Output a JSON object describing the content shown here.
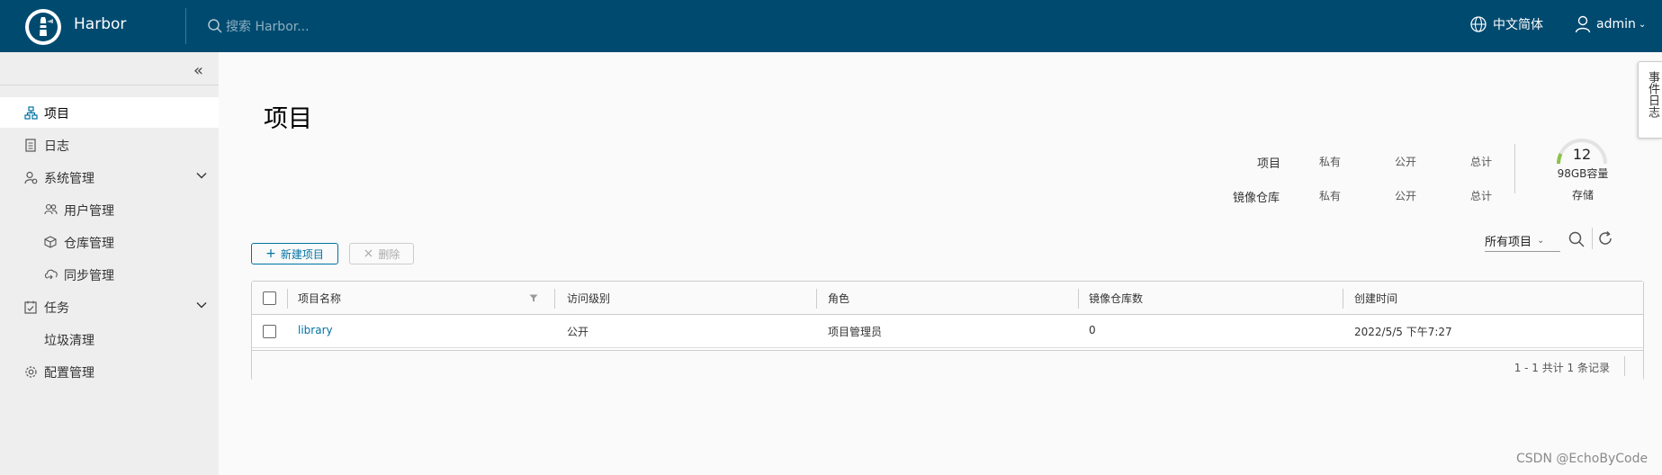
{
  "header": {
    "brand": "Harbor",
    "search_placeholder": "搜索 Harbor...",
    "language": "中文简体",
    "user": "admin"
  },
  "sidebar": {
    "items": [
      {
        "label": "项目",
        "icon": "project-icon",
        "active": true
      },
      {
        "label": "日志",
        "icon": "log-icon"
      },
      {
        "label": "系统管理",
        "icon": "system-admin-icon",
        "expanded": true
      },
      {
        "label": "用户管理",
        "icon": "users-icon"
      },
      {
        "label": "仓库管理",
        "icon": "registry-icon"
      },
      {
        "label": "同步管理",
        "icon": "replication-icon"
      },
      {
        "label": "任务",
        "icon": "tasks-icon",
        "expanded": true
      },
      {
        "label": "垃圾清理",
        "icon": ""
      },
      {
        "label": "配置管理",
        "icon": "config-icon"
      }
    ]
  },
  "main": {
    "title": "项目",
    "stats": {
      "row1_label": "项目",
      "row2_label": "镜像仓库",
      "private": "私有",
      "public": "公开",
      "total": "总计",
      "gauge_value": "12",
      "gauge_caption": "98GB容量",
      "gauge_storage": "存储"
    },
    "buttons": {
      "new_project": "新建项目",
      "delete": "删除"
    },
    "filter": "所有项目",
    "table": {
      "columns": [
        "项目名称",
        "访问级别",
        "角色",
        "镜像仓库数",
        "创建时间"
      ],
      "rows": [
        {
          "name": "library",
          "access": "公开",
          "role": "项目管理员",
          "repo_count": "0",
          "created": "2022/5/5 下午7:27"
        }
      ],
      "footer": "1 - 1 共计 1 条记录"
    }
  },
  "event_log": "事件日志",
  "watermark": "CSDN @EchoByCode",
  "colors": {
    "header_bg": "#004a70",
    "accent": "#0072a3",
    "sidebar_bg": "#eeeeee",
    "gauge_green": "#8bc34a"
  }
}
